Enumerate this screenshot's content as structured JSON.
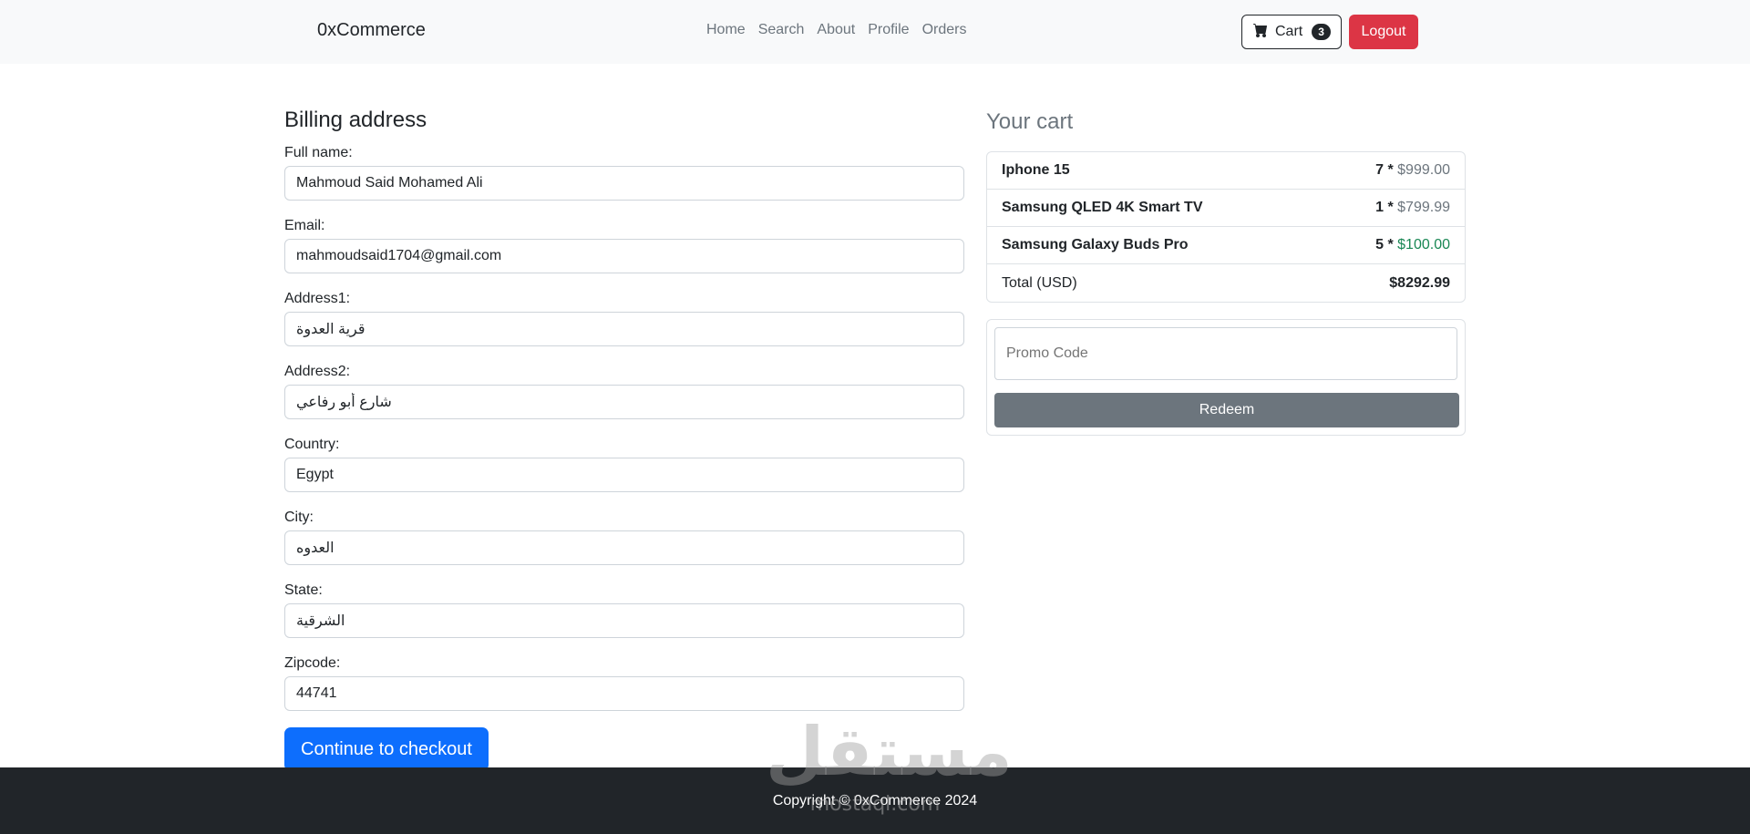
{
  "navbar": {
    "brand": "0xCommerce",
    "links": [
      "Home",
      "Search",
      "About",
      "Profile",
      "Orders"
    ],
    "cart_label": "Cart",
    "cart_count": "3",
    "logout_label": "Logout"
  },
  "billing": {
    "title": "Billing address",
    "fields": [
      {
        "label": "Full name:",
        "value": "Mahmoud Said Mohamed Ali"
      },
      {
        "label": "Email:",
        "value": "mahmoudsaid1704@gmail.com"
      },
      {
        "label": "Address1:",
        "value": "قرية العدوة"
      },
      {
        "label": "Address2:",
        "value": "شارع أبو رفاعي"
      },
      {
        "label": "Country:",
        "value": "Egypt"
      },
      {
        "label": "City:",
        "value": "العدوه"
      },
      {
        "label": "State:",
        "value": "الشرقية"
      },
      {
        "label": "Zipcode:",
        "value": "44741"
      }
    ],
    "submit_label": "Continue to checkout"
  },
  "cart": {
    "title": "Your cart",
    "items": [
      {
        "name": "Iphone 15",
        "qty": "7 *",
        "price": "$999.00"
      },
      {
        "name": "Samsung QLED 4K Smart TV",
        "qty": "1 *",
        "price": "$799.99"
      },
      {
        "name": "Samsung Galaxy Buds Pro",
        "qty": "5 *",
        "price": "$100.00"
      }
    ],
    "total_label": "Total (USD)",
    "total_value": "$8292.99",
    "promo_placeholder": "Promo Code",
    "redeem_label": "Redeem"
  },
  "footer": {
    "text": "Copyright © 0xCommerce 2024"
  },
  "watermark": {
    "arabic": "مستقل",
    "domain": "mostaql.com"
  },
  "colors": {
    "primary": "#0d6efd",
    "danger": "#dc3545",
    "secondary": "#6c757d",
    "success": "#198754",
    "dark": "#212529"
  }
}
